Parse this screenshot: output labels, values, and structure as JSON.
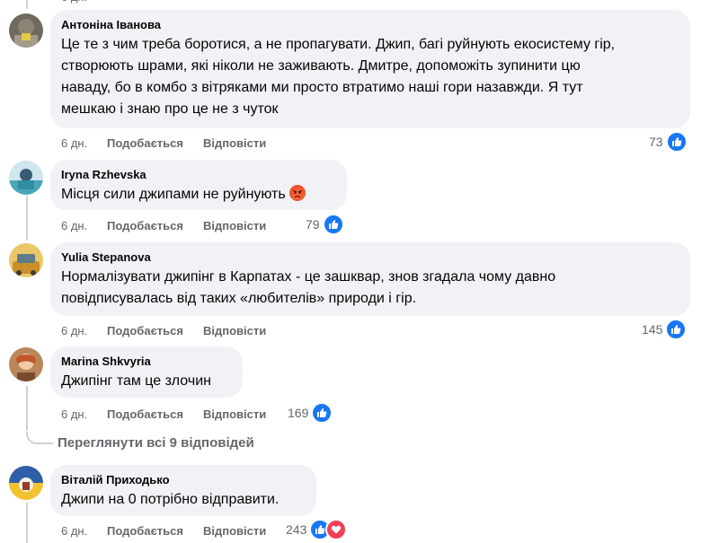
{
  "comments": [
    {
      "author": "Антоніна Іванова",
      "text": "Це те з чим треба боротися, а не пропагувати. Джип, багі руйнують екосистему гір,\nстворюють шрами, які ніколи не заживають. Дмитре, допоможіть зупинити цю\nнаваду, бо в комбо з вітряками ми просто втратимо наші гори назавжди. Я тут\nмешкаю і знаю про це не з чуток",
      "time": "6 дн.",
      "like_label": "Подобається",
      "reply_label": "Відповісти",
      "reaction_count": "73",
      "reactions": [
        "like-icon"
      ]
    },
    {
      "author": "Iryna Rzhevska",
      "text": "Місця сили джипами не руйнують",
      "emoji": "angry-face-icon",
      "time": "6 дн.",
      "like_label": "Подобається",
      "reply_label": "Відповісти",
      "reaction_count": "79",
      "reactions": [
        "like-icon"
      ]
    },
    {
      "author": "Yulia Stepanova",
      "text": "Нормалізувати джипінг в Карпатах - це зашквар, знов згадала чому давно\nповідписувалась від таких «любителів» природи і гір.",
      "time": "6 дн.",
      "like_label": "Подобається",
      "reply_label": "Відповісти",
      "reaction_count": "145",
      "reactions": [
        "like-icon"
      ]
    },
    {
      "author": "Marina Shkvyria",
      "text": "Джипінг там це злочин",
      "time": "6 дн.",
      "like_label": "Подобається",
      "reply_label": "Відповісти",
      "reaction_count": "169",
      "reactions": [
        "like-icon"
      ]
    },
    {
      "author": "Віталій Приходько",
      "text": "Джипи на 0 потрібно відправити.",
      "time": "6 дн.",
      "like_label": "Подобається",
      "reply_label": "Відповісти",
      "reaction_count": "243",
      "reactions": [
        "like-icon",
        "love-icon"
      ]
    }
  ],
  "view_replies_label": "Переглянути всі 9 відповідей",
  "colors": {
    "bubble": "#f0f2f5",
    "muted_text": "#65676b",
    "like_blue": "#1877f2",
    "love_red": "#f33e58"
  }
}
